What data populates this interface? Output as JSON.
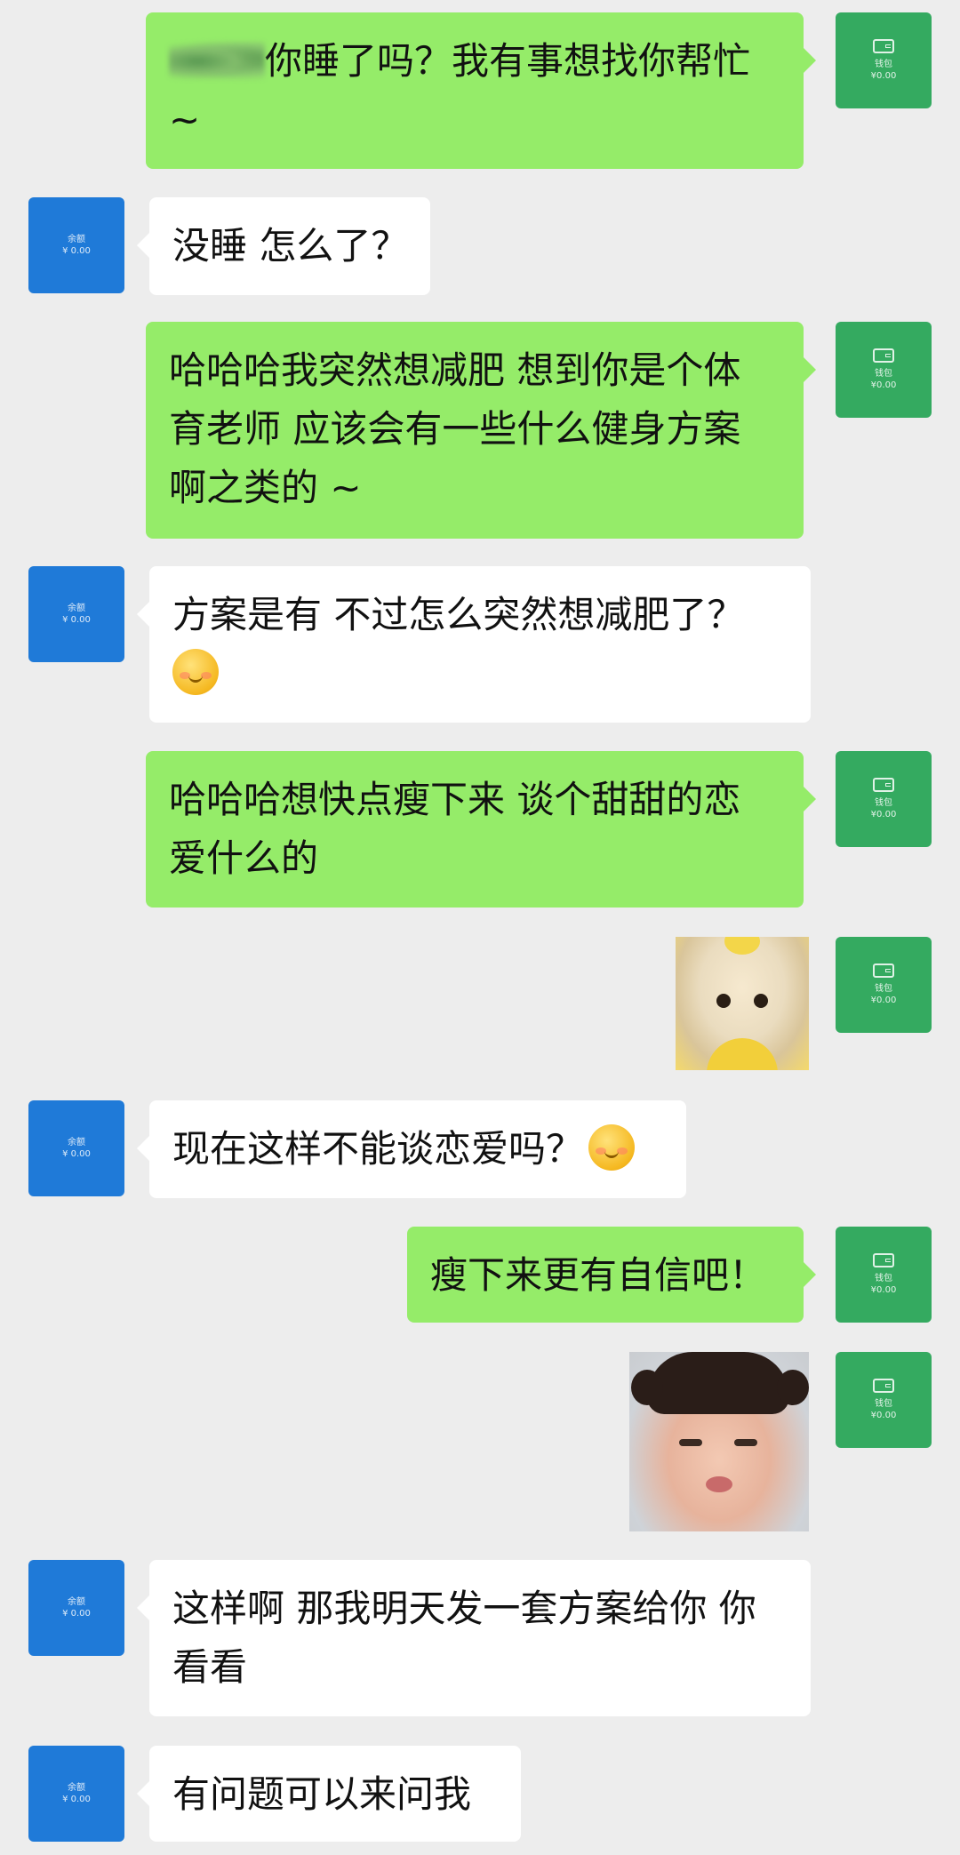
{
  "avatars": {
    "friend": {
      "line1": "余额",
      "line2": "¥ 0.00"
    },
    "self": {
      "line1": "钱包",
      "line2": "¥0.00"
    }
  },
  "messages": [
    {
      "from": "self",
      "text": "你睡了吗？我有事想找你帮忙\n~"
    },
    {
      "from": "friend",
      "text": "没睡 怎么了？"
    },
    {
      "from": "self",
      "text": "哈哈哈我突然想减肥 想到你是个体\n育老师 应该会有一些什么健身方案\n啊之类的 ~"
    },
    {
      "from": "friend",
      "text": "方案是有 不过怎么突然想减肥了？"
    },
    {
      "from": "self",
      "text": "哈哈哈想快点瘦下来 谈个甜甜的恋\n爱什么的"
    },
    {
      "from": "self",
      "sticker": "teletubby-sticker"
    },
    {
      "from": "friend",
      "text": "现在这样不能谈恋爱吗？"
    },
    {
      "from": "self",
      "text": "瘦下来更有自信吧！"
    },
    {
      "from": "self",
      "sticker": "pouting-baby-sticker"
    },
    {
      "from": "friend",
      "text": "这样啊 那我明天发一套方案给你 你\n看看"
    },
    {
      "from": "friend",
      "text": "有问题可以来问我"
    }
  ],
  "colors": {
    "background": "#ededed",
    "self_bubble": "#95ec69",
    "friend_bubble": "#ffffff",
    "friend_avatar": "#1f7ad8",
    "self_avatar": "#34aa60"
  }
}
